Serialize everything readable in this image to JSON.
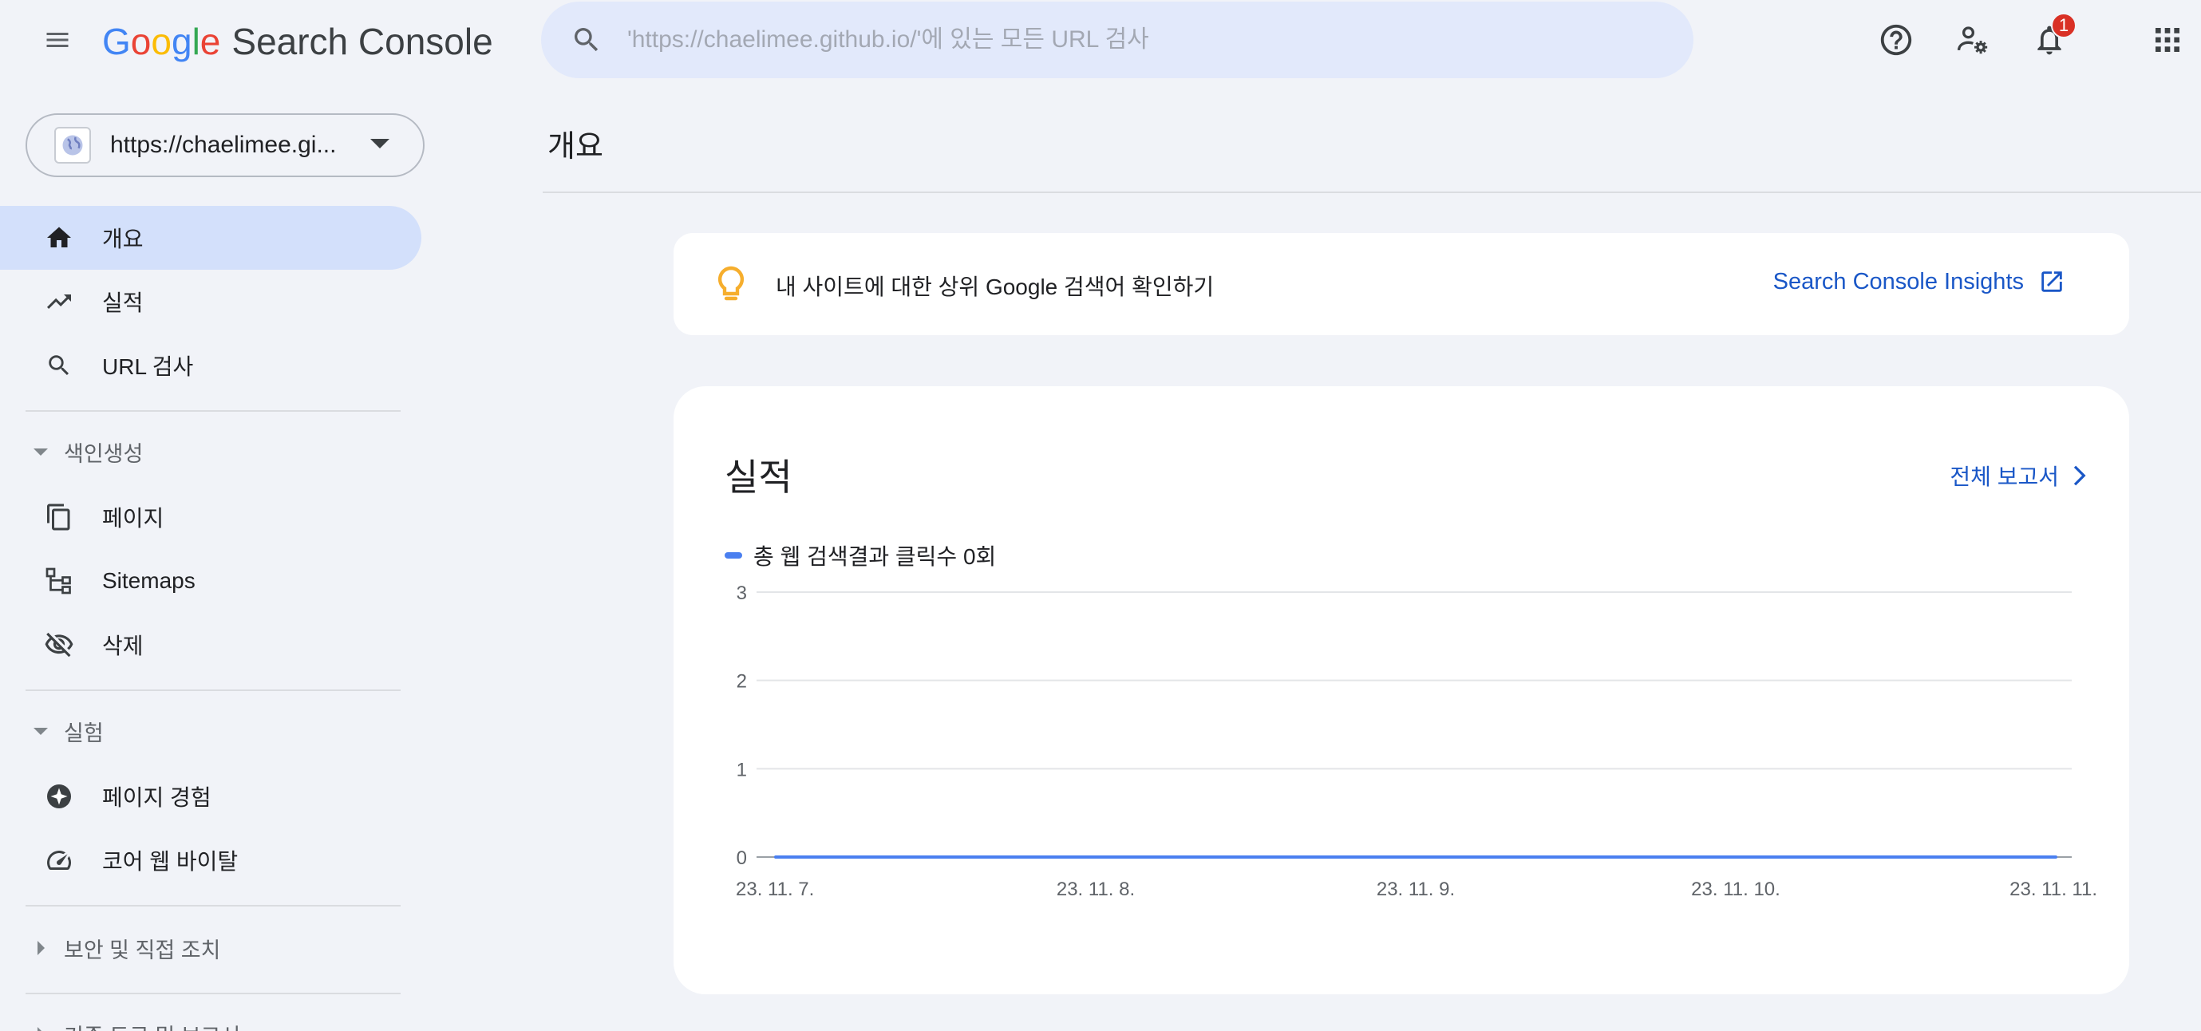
{
  "header": {
    "logo_google": [
      "G",
      "o",
      "o",
      "g",
      "l",
      "e"
    ],
    "logo_product": "Search Console",
    "search_placeholder": "'https://chaelimee.github.io/'에 있는 모든 URL 검사",
    "notification_count": "1",
    "icons": [
      "menu-icon",
      "search-icon",
      "help-icon",
      "manage-users-icon",
      "notifications-icon",
      "apps-icon"
    ]
  },
  "sidebar": {
    "property": "https://chaelimee.gi...",
    "nav": [
      {
        "label": "개요",
        "icon": "home-icon",
        "active": true
      },
      {
        "label": "실적",
        "icon": "trending-up-icon"
      },
      {
        "label": "URL 검사",
        "icon": "search-icon"
      }
    ],
    "sections": [
      {
        "label": "색인생성",
        "expanded": true,
        "items": [
          {
            "label": "페이지",
            "icon": "pages-icon"
          },
          {
            "label": "Sitemaps",
            "icon": "sitemap-icon"
          },
          {
            "label": "삭제",
            "icon": "visibility-off-icon"
          }
        ]
      },
      {
        "label": "실험",
        "expanded": true,
        "items": [
          {
            "label": "페이지 경험",
            "icon": "page-experience-icon"
          },
          {
            "label": "코어 웹 바이탈",
            "icon": "speed-gauge-icon"
          }
        ]
      },
      {
        "label": "보안 및 직접 조치",
        "expanded": false
      },
      {
        "label": "기존 도구 및 보고서",
        "expanded": false
      }
    ]
  },
  "main": {
    "page_title": "개요",
    "insight": {
      "text": "내 사이트에 대한 상위 Google 검색어 확인하기",
      "link_label": "Search Console Insights"
    },
    "performance": {
      "title": "실적",
      "full_report": "전체 보고서"
    }
  },
  "colors": {
    "accent_blue": "#1a57c7",
    "series_blue": "#4a7ff0",
    "active_nav_bg": "#d3e0fb",
    "bulb_yellow": "#f6ae2d",
    "badge_red": "#d93025"
  },
  "chart_data": {
    "type": "line",
    "title": "",
    "xlabel": "",
    "ylabel": "",
    "x": [
      "23. 11. 7.",
      "23. 11. 8.",
      "23. 11. 9.",
      "23. 11. 10.",
      "23. 11. 11."
    ],
    "series": [
      {
        "name": "총 웹 검색결과 클릭수 0회",
        "values": [
          0,
          0,
          0,
          0,
          0
        ]
      }
    ],
    "yticks": [
      0,
      1,
      2,
      3
    ],
    "ylim": [
      0,
      3
    ],
    "grid": true,
    "legend": "top-left"
  }
}
